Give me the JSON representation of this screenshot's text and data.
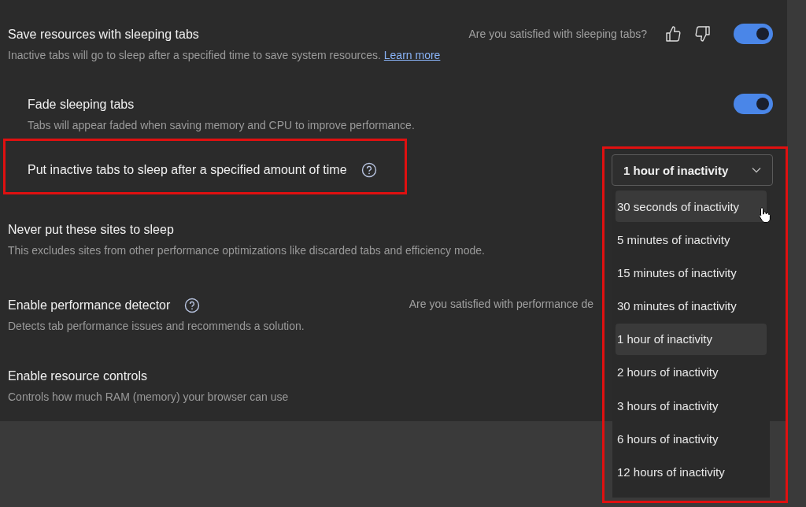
{
  "settings": [
    {
      "kind": "toggle",
      "title": "Save resources with sleeping tabs",
      "description": "Inactive tabs will go to sleep after a specified time to save system resources.",
      "link": "Learn more",
      "feedback": "Are you satisfied with sleeping tabs?",
      "on": true,
      "children": [
        {
          "kind": "toggle",
          "title": "Fade sleeping tabs",
          "description": "Tabs will appear faded when saving memory and CPU to improve performance.",
          "on": true
        },
        {
          "kind": "dropdown",
          "title": "Put inactive tabs to sleep after a specified amount of time",
          "help": true,
          "value": "1 hour of inactivity",
          "expanded": true,
          "highlighted": true
        }
      ]
    },
    {
      "kind": "plain",
      "title": "Never put these sites to sleep",
      "description": "This excludes sites from other performance optimizations like discarded tabs and efficiency mode."
    },
    {
      "kind": "plain",
      "title": "Enable performance detector",
      "description": "Detects tab performance issues and recommends a solution.",
      "feedback": "Are you satisfied with performance de",
      "help": true
    },
    {
      "kind": "plain",
      "title": "Enable resource controls",
      "description": "Controls how much RAM (memory) your browser can use"
    }
  ],
  "menu": {
    "highlighted": true,
    "options": [
      {
        "label": "30 seconds of inactivity",
        "selected": false,
        "hovered": true
      },
      {
        "label": "5 minutes of inactivity",
        "selected": false,
        "hovered": false
      },
      {
        "label": "15 minutes of inactivity",
        "selected": false,
        "hovered": false
      },
      {
        "label": "30 minutes of inactivity",
        "selected": false,
        "hovered": false
      },
      {
        "label": "1 hour of inactivity",
        "selected": true,
        "hovered": false
      },
      {
        "label": "2 hours of inactivity",
        "selected": false,
        "hovered": false
      },
      {
        "label": "3 hours of inactivity",
        "selected": false,
        "hovered": false
      },
      {
        "label": "6 hours of inactivity",
        "selected": false,
        "hovered": false
      },
      {
        "label": "12 hours of inactivity",
        "selected": false,
        "hovered": false
      }
    ]
  }
}
